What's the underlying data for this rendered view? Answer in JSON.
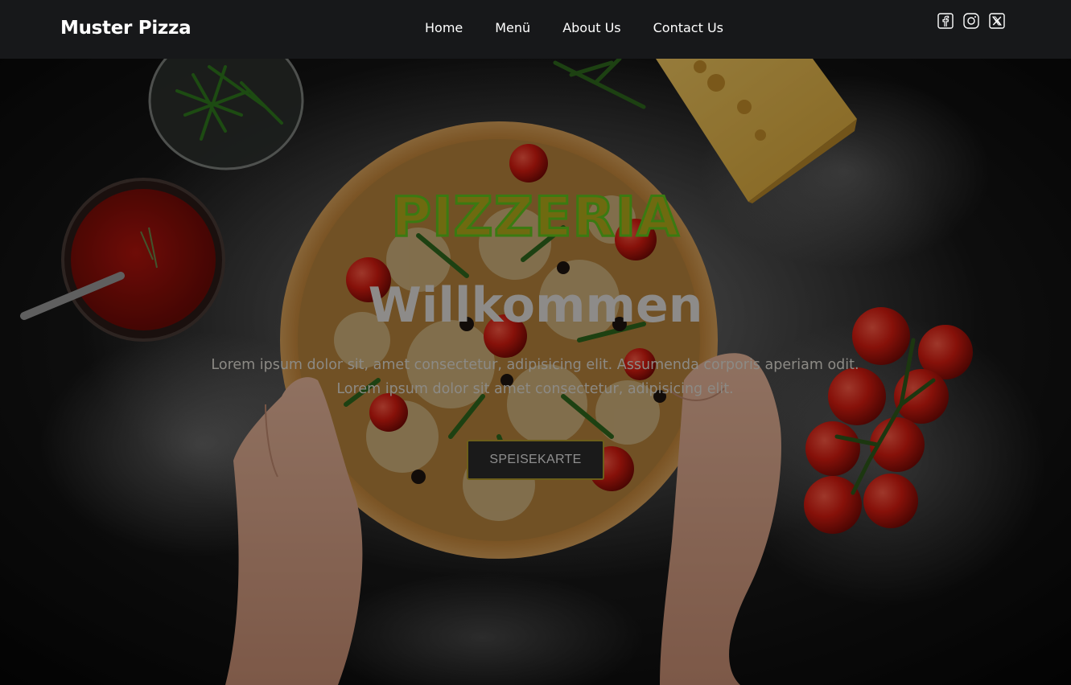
{
  "header": {
    "brand": "Muster Pizza",
    "nav": [
      {
        "label": "Home"
      },
      {
        "label": "Menü"
      },
      {
        "label": "About Us"
      },
      {
        "label": "Contact Us"
      }
    ],
    "socials": [
      {
        "icon": "facebook-icon"
      },
      {
        "icon": "instagram-icon"
      },
      {
        "icon": "x-twitter-icon"
      }
    ]
  },
  "hero": {
    "title": "PIZZERIA",
    "welcome": "Willkommen",
    "text_line1": "Lorem ipsum dolor sit, amet consectetur, adipisicing elit. Assumenda corporis aperiam odit.",
    "text_line2": "Lorem ipsum dolor sit amet consectetur, adipisicing elit.",
    "button_label": "SPEISEKARTE"
  },
  "colors": {
    "navbar_bg": "#17181a",
    "title_fill": "#6e6a10",
    "title_stroke": "#3b7a12",
    "button_border": "#6c5e1a"
  }
}
